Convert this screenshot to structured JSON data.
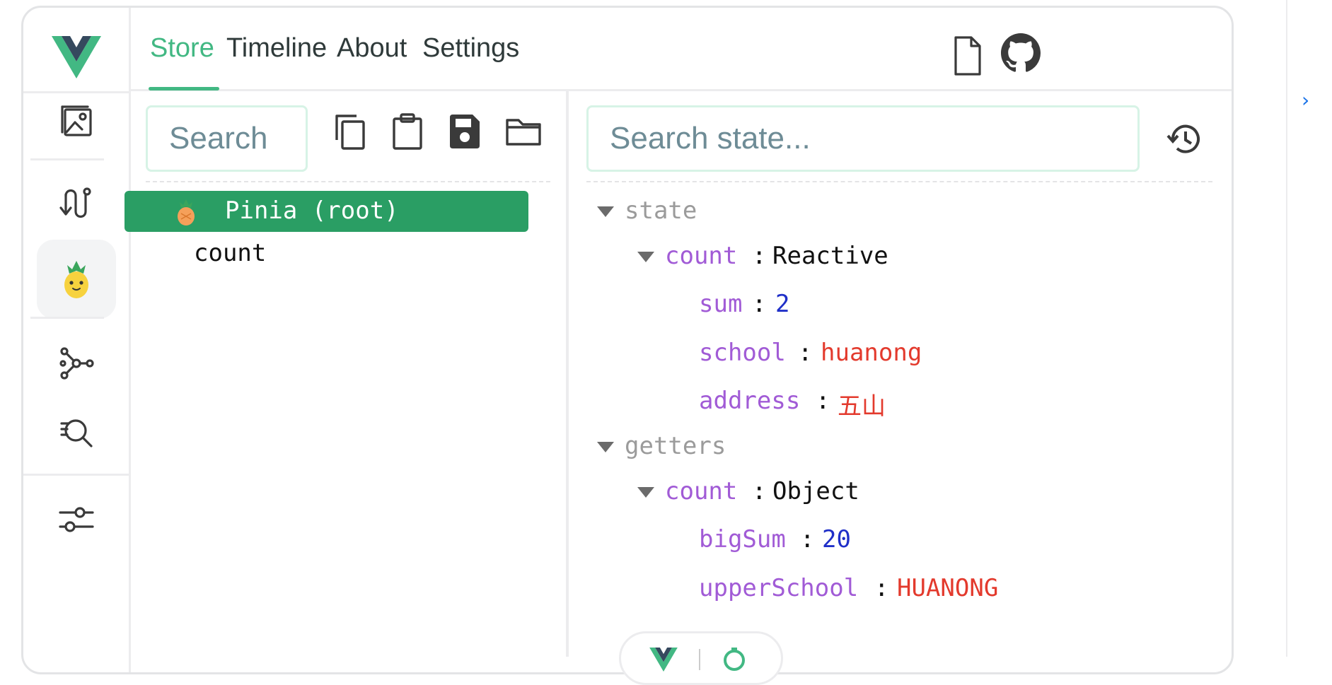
{
  "tabs": [
    {
      "label": "Store",
      "active": true
    },
    {
      "label": "Timeline",
      "active": false
    },
    {
      "label": "About",
      "active": false
    },
    {
      "label": "Settings",
      "active": false
    }
  ],
  "left_search": {
    "placeholder": "Search"
  },
  "right_search": {
    "placeholder": "Search state..."
  },
  "tree": {
    "root_label": "Pinia (root)",
    "child_label": "count"
  },
  "inspector": {
    "state_label": "state",
    "state_count_key": "count",
    "state_count_type": "Reactive",
    "state_fields": [
      {
        "key": "sum",
        "value": "2",
        "kind": "num"
      },
      {
        "key": "school",
        "value": "huanong",
        "kind": "str"
      },
      {
        "key": "address",
        "value": "五山",
        "kind": "str"
      }
    ],
    "getters_label": "getters",
    "getters_count_key": "count",
    "getters_count_type": "Object",
    "getter_fields": [
      {
        "key": "bigSum",
        "value": "20",
        "kind": "num"
      },
      {
        "key": "upperSchool",
        "value": "HUANONG",
        "kind": "str"
      }
    ],
    "colon": ":"
  },
  "colors": {
    "accent": "#42b883",
    "selected_row": "#2a9e64",
    "key": "#a15bd6",
    "number": "#1f2fc8",
    "string": "#e33a2d",
    "muted": "#9b9b9b"
  },
  "icons": [
    "vue-logo-icon",
    "image-icon",
    "timeline-route-icon",
    "pinia-icon",
    "graph-nodes-icon",
    "search-text-icon",
    "settings-sliders-icon",
    "document-icon",
    "github-icon",
    "copy-icon",
    "clipboard-icon",
    "save-icon",
    "folder-icon",
    "history-icon",
    "chevron-right-icon"
  ]
}
